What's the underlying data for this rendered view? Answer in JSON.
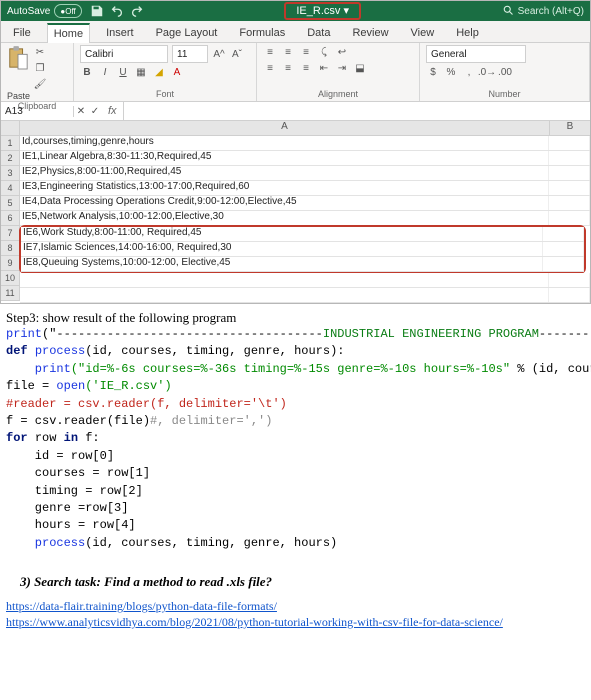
{
  "titlebar": {
    "autosave_label": "AutoSave",
    "autosave_state": "Off",
    "filename": "IE_R.csv",
    "search_placeholder": "Search (Alt+Q)"
  },
  "tabs": {
    "file": "File",
    "home": "Home",
    "insert": "Insert",
    "pagelayout": "Page Layout",
    "formulas": "Formulas",
    "data": "Data",
    "review": "Review",
    "view": "View",
    "help": "Help"
  },
  "ribbon": {
    "clipboard_label": "Clipboard",
    "paste_label": "Paste",
    "font_label": "Font",
    "font_name": "Calibri",
    "font_size": "11",
    "alignment_label": "Alignment",
    "number_label": "Number",
    "number_format": "General"
  },
  "fx": {
    "namebox": "A13",
    "formula": ""
  },
  "sheet": {
    "colA": "A",
    "colB": "B",
    "rows": [
      "Id,courses,timing,genre,hours",
      "IE1,Linear Algebra,8:30-11:30,Required,45",
      "IE2,Physics,8:00-11:00,Required,45",
      "IE3,Engineering Statistics,13:00-17:00,Required,60",
      "IE4,Data Processing Operations Credit,9:00-12:00,Elective,45",
      "IE5,Network Analysis,10:00-12:00,Elective,30",
      "IE6,Work Study,8:00-11:00, Required,45",
      "IE7,Islamic Sciences,14:00-16:00, Required,30",
      "IE8,Queuing Systems,10:00-12:00, Elective,45"
    ],
    "rn": [
      "1",
      "2",
      "3",
      "4",
      "5",
      "6",
      "7",
      "8",
      "9",
      "10",
      "11"
    ]
  },
  "doc": {
    "step3": "Step3: show result of the following program",
    "code": {
      "l1a": "print",
      "l1b": "(\"-------------------------------------",
      "l1c": "INDUSTRIAL ENGINEERING PROGRAM",
      "l1d": "----------------------------\")",
      "l2a": "def ",
      "l2b": "process",
      "l2c": "(id, courses, timing, genre, hours):",
      "l3a": "    print",
      "l3b": "(\"id=%-6s courses=%-36s timing=%-15s genre=%-10s hours=%-10s\" ",
      "l3c": "% (id, courses, timing, genre, hours))",
      "l4a": "file = ",
      "l4b": "open",
      "l4c": "('IE_R.csv')",
      "l5": "#reader = csv.reader(f, delimiter='\\t')",
      "l6a": "f = csv.reader(file)",
      "l6b": "#, delimiter=',')",
      "l7a": "for ",
      "l7b": "row ",
      "l7c": "in ",
      "l7d": "f:",
      "l8": "    id = row[0]",
      "l9": "    courses = row[1]",
      "l10": "    timing = row[2]",
      "l11": "    genre =row[3]",
      "l12": "    hours = row[4]",
      "l13a": "    process",
      "l13b": "(id, courses, timing, genre, hours)"
    },
    "task_heading": "3)  Search task: Find a method to read .xls file?",
    "link1": "https://data-flair.training/blogs/python-data-file-formats/",
    "link2": "https://www.analyticsvidhya.com/blog/2021/08/python-tutorial-working-with-csv-file-for-data-science/"
  }
}
